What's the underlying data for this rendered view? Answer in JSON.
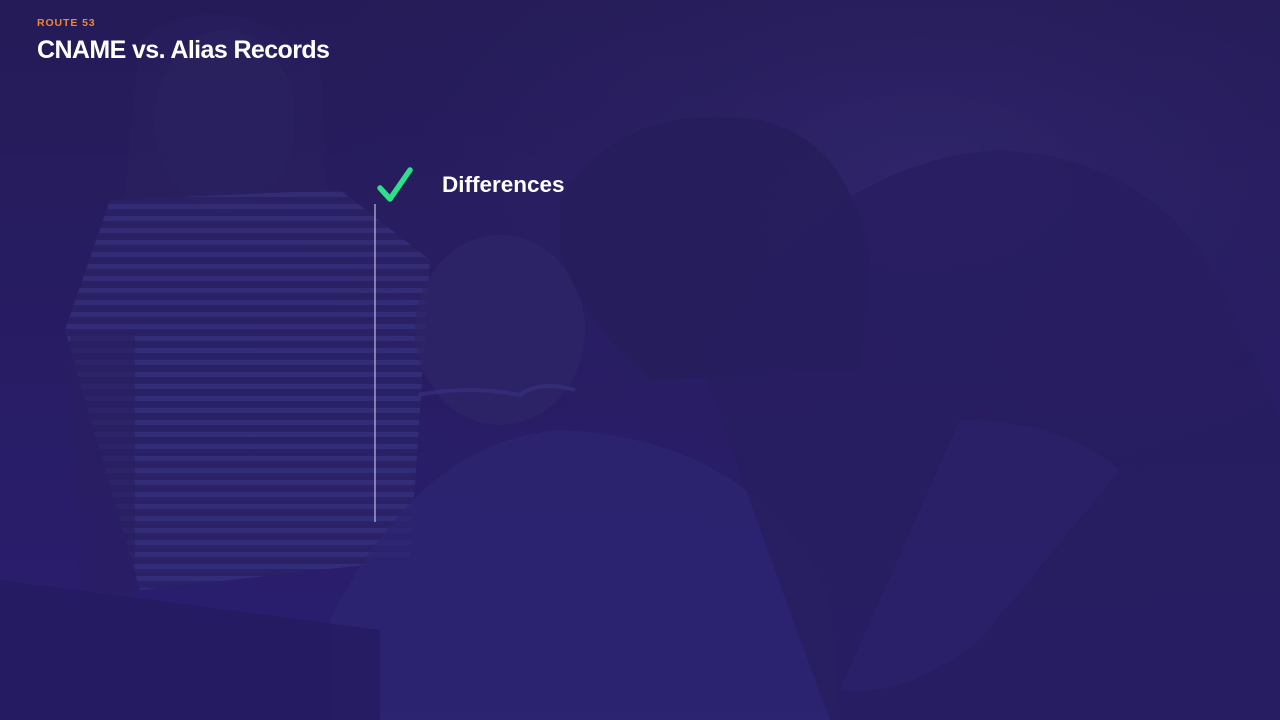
{
  "slide": {
    "kicker": "ROUTE 53",
    "title": "CNAME vs. Alias Records"
  },
  "checklist": {
    "items": [
      {
        "label": "Differences",
        "checked": true,
        "icon": "checkmark-icon"
      }
    ]
  },
  "colors": {
    "background": "#221a52",
    "overlay": "#2a1e6e",
    "kicker": "#f0853a",
    "title": "#ffffff",
    "check": "#2ee08a"
  }
}
